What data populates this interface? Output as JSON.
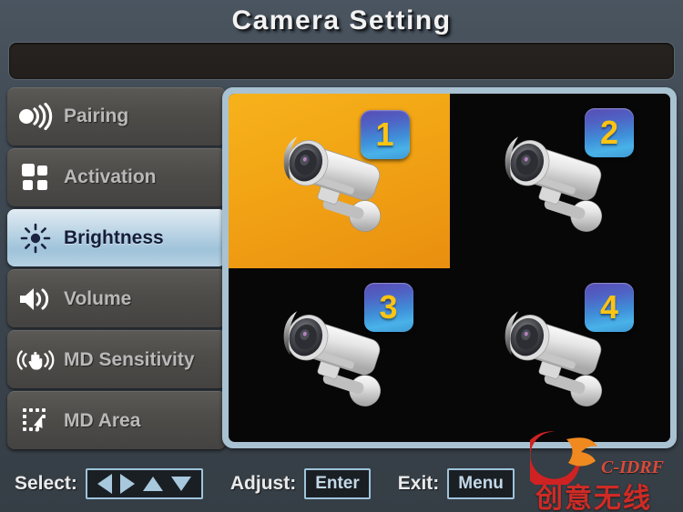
{
  "header": {
    "title": "Camera Setting",
    "value_bar_text": ""
  },
  "sidebar": {
    "items": [
      {
        "id": "pairing",
        "label": "Pairing",
        "icon": "pairing-signal-icon",
        "selected": false
      },
      {
        "id": "activation",
        "label": "Activation",
        "icon": "grid-squares-icon",
        "selected": false
      },
      {
        "id": "brightness",
        "label": "Brightness",
        "icon": "brightness-sun-icon",
        "selected": true
      },
      {
        "id": "volume",
        "label": "Volume",
        "icon": "speaker-volume-icon",
        "selected": false
      },
      {
        "id": "md-sensitivity",
        "label": "MD Sensitivity",
        "icon": "hand-motion-icon",
        "selected": false
      },
      {
        "id": "md-area",
        "label": "MD Area",
        "icon": "dotted-area-icon",
        "selected": false
      }
    ]
  },
  "camera_grid": {
    "cameras": [
      {
        "number": "1",
        "selected": true
      },
      {
        "number": "2",
        "selected": false
      },
      {
        "number": "3",
        "selected": false
      },
      {
        "number": "4",
        "selected": false
      }
    ]
  },
  "status_bar": {
    "select_label": "Select:",
    "adjust_label": "Adjust:",
    "adjust_key": "Enter",
    "exit_label": "Exit:",
    "exit_key": "Menu",
    "arrows": [
      "left-arrow-icon",
      "right-arrow-icon",
      "up-arrow-icon",
      "down-arrow-icon"
    ]
  },
  "watermark": {
    "brand": "C-IDRF",
    "chinese": "创意无线"
  },
  "colors": {
    "accent_selected_camera": "#f2a515",
    "badge_number": "#fdc412",
    "menu_selected_bg": "#b9d3e4",
    "frame_border": "#a9c2d2",
    "key_border": "#9ec4dc"
  }
}
